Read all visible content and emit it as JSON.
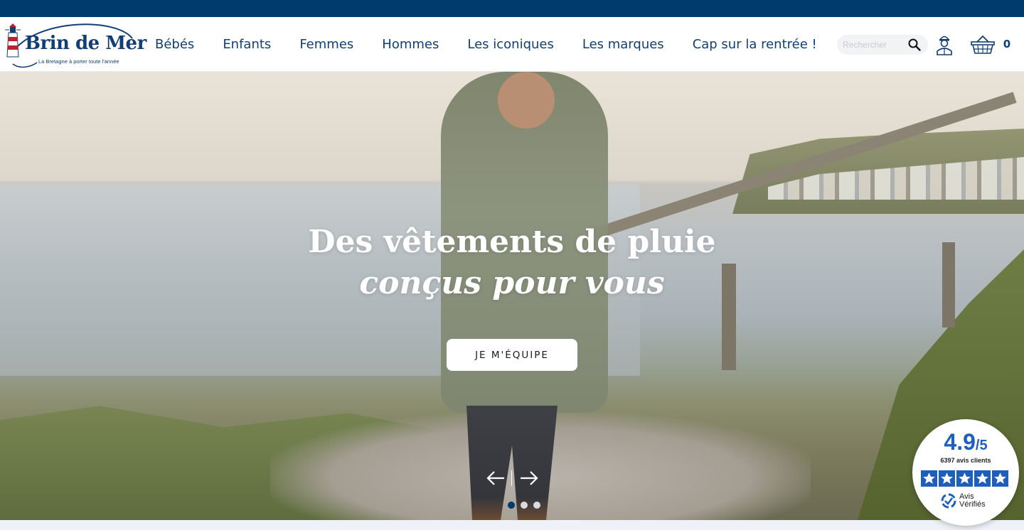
{
  "brand": {
    "name": "Brin de Mer",
    "tagline": "La Bretagne à porter toute l'année"
  },
  "nav": {
    "items": [
      "Bébés",
      "Enfants",
      "Femmes",
      "Hommes",
      "Les iconiques",
      "Les marques",
      "Cap sur la rentrée !"
    ]
  },
  "search": {
    "placeholder": "Rechercher"
  },
  "cart": {
    "count": "0"
  },
  "hero": {
    "title_line1": "Des vêtements de pluie",
    "title_line2": "conçus pour vous",
    "cta_label": "JE M'ÉQUIPE",
    "slides_total": 3,
    "active_slide": 1
  },
  "reviews": {
    "score": "4.9",
    "scale": "/5",
    "count_label": "6397 avis clients",
    "stars": 5,
    "provider_line1": "Avis",
    "provider_line2": "Vérifiés"
  },
  "colors": {
    "topbar": "#003b6e",
    "brand_text": "#123f73",
    "review_blue": "#1d5fbf"
  }
}
